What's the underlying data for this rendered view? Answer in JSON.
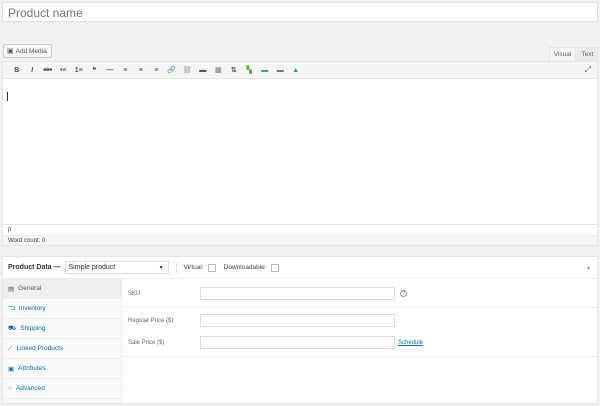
{
  "title": {
    "placeholder": "Product name"
  },
  "editor": {
    "add_media": "Add Media",
    "tabs": {
      "visual": "Visual",
      "text": "Text"
    },
    "toolbar": [
      "B",
      "I",
      "abc",
      "•≡",
      "1≡",
      "❝",
      "—",
      "≡",
      "≡",
      "≡",
      "🔗",
      "⛓",
      "▬",
      "▦",
      "⇅",
      "▚",
      "▬",
      "▬",
      "▲"
    ],
    "path": "p",
    "word_count": "Word count: 0"
  },
  "product_data": {
    "label": "Product Data —",
    "type": "Simple product",
    "virtual": "Virtual:",
    "downloadable": "Downloadable:",
    "tabs": [
      {
        "icon": "▤",
        "label": "General"
      },
      {
        "icon": "⫎",
        "label": "Inventory"
      },
      {
        "icon": "⛟",
        "label": "Shipping"
      },
      {
        "icon": "⟋",
        "label": "Linked Products"
      },
      {
        "icon": "▣",
        "label": "Attributes"
      },
      {
        "icon": "○",
        "label": "Advanced"
      }
    ],
    "fields": {
      "sku": "SKU",
      "regular": "Regular Price ($)",
      "sale": "Sale Price ($)",
      "schedule": "Schedule",
      "help": "?"
    }
  }
}
